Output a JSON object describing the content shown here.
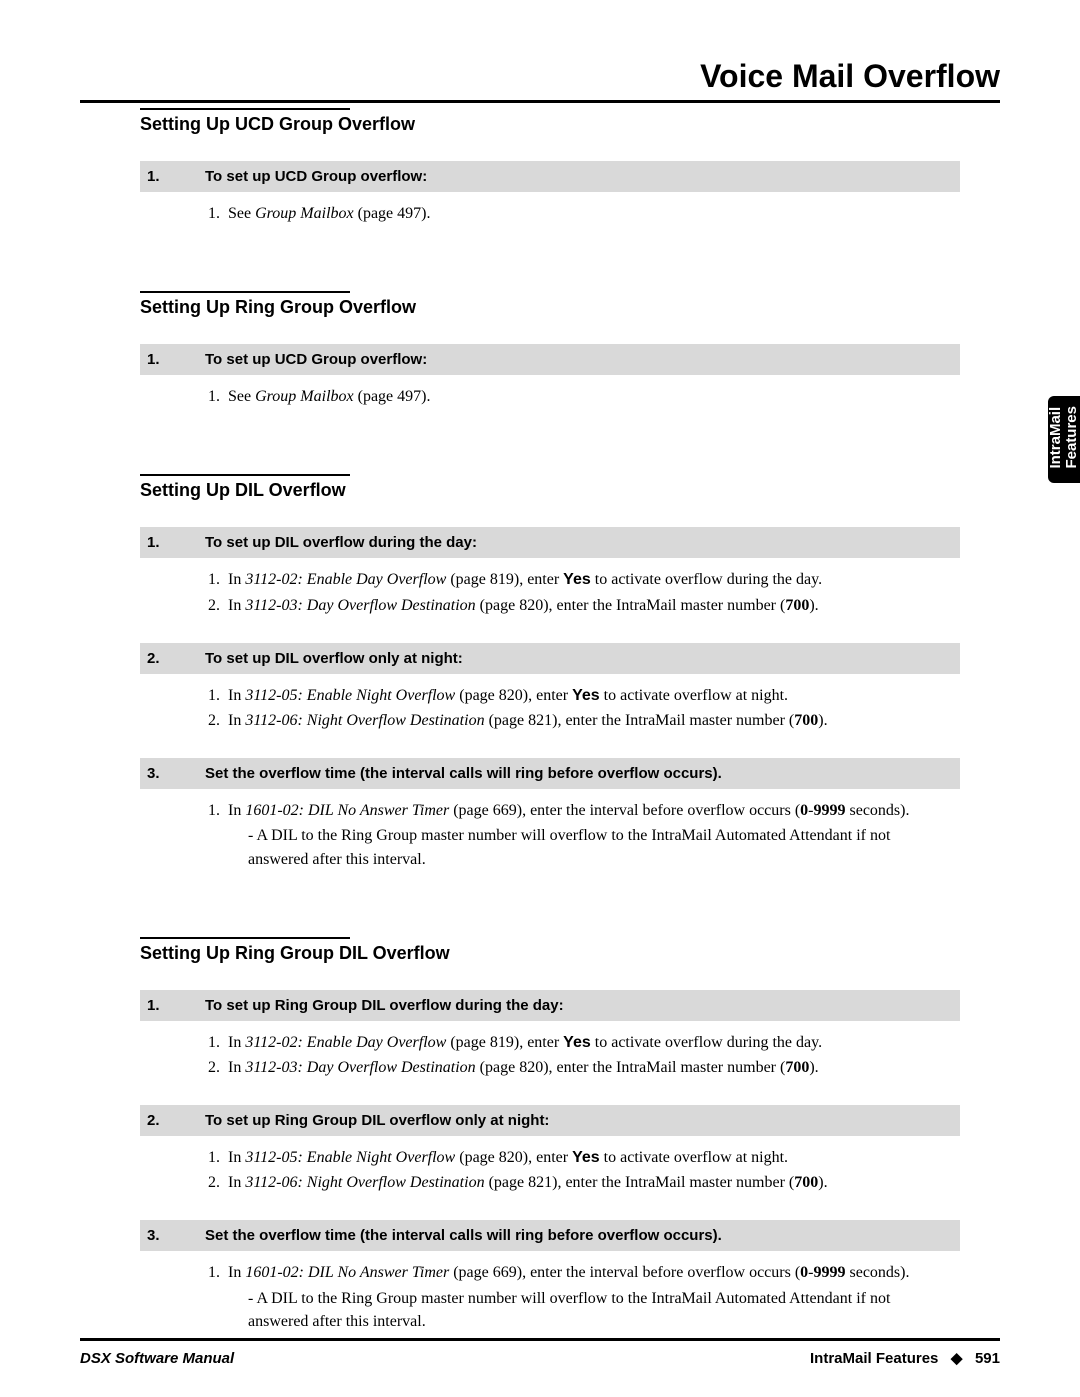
{
  "page_title": "Voice Mail Overflow",
  "tab_label": "IntraMail Features",
  "footer": {
    "left": "DSX Software Manual",
    "right_label": "IntraMail Features",
    "diamond": "◆",
    "page": "591"
  },
  "sections": [
    {
      "heading": "Setting Up UCD Group Overflow",
      "steps": [
        {
          "num": "1.",
          "title": "To set up UCD Group overflow:",
          "items": [
            {
              "html": "See <em>Group Mailbox</em> (page 497)."
            }
          ]
        }
      ]
    },
    {
      "heading": "Setting Up Ring Group Overflow",
      "steps": [
        {
          "num": "1.",
          "title": "To set up UCD Group overflow:",
          "items": [
            {
              "html": "See <em>Group Mailbox</em> (page 497)."
            }
          ]
        }
      ]
    },
    {
      "heading": "Setting Up DIL Overflow",
      "steps": [
        {
          "num": "1.",
          "title": "To set up DIL overflow during the day:",
          "items": [
            {
              "html": "In <em>3112-02: Enable Day Overflow</em> (page 819), enter <b>Yes</b> to activate overflow during the day."
            },
            {
              "html": "In <em>3112-03: Day Overflow Destination</em> (page 820), enter the IntraMail master number (<span class='serif-bold'>700</span>)."
            }
          ]
        },
        {
          "num": "2.",
          "title": "To set up DIL overflow only at night:",
          "items": [
            {
              "html": "In <em>3112-05: Enable Night Overflow</em> (page 820), enter <b>Yes</b> to activate overflow at night."
            },
            {
              "html": "In <em>3112-06: Night Overflow Destination</em> (page 821), enter the IntraMail master number (<span class='serif-bold'>700</span>)."
            }
          ]
        },
        {
          "num": "3.",
          "title": "Set the overflow time (the interval calls will ring before overflow occurs).",
          "items": [
            {
              "html": "In <em>1601-02: DIL No Answer Timer</em> (page 669), enter the interval before overflow occurs (<span class='serif-bold'>0</span>-<span class='serif-bold'>9999</span> seconds).",
              "sub": [
                "A DIL to the Ring Group master number will overflow to the IntraMail Automated Attendant if not answered after this interval."
              ]
            }
          ]
        }
      ]
    },
    {
      "heading": "Setting Up Ring Group DIL Overflow",
      "steps": [
        {
          "num": "1.",
          "title": "To set up Ring Group DIL overflow during the day:",
          "items": [
            {
              "html": "In <em>3112-02: Enable Day Overflow</em> (page 819), enter <b>Yes</b> to activate overflow during the day."
            },
            {
              "html": "In <em>3112-03: Day Overflow Destination</em> (page 820), enter the IntraMail master number (<span class='serif-bold'>700</span>)."
            }
          ]
        },
        {
          "num": "2.",
          "title": "To set up Ring Group DIL overflow only at night:",
          "items": [
            {
              "html": "In <em>3112-05: Enable Night Overflow</em> (page 820), enter <b>Yes</b> to activate overflow at night."
            },
            {
              "html": "In <em>3112-06: Night Overflow Destination</em> (page 821), enter the IntraMail master number (<span class='serif-bold'>700</span>)."
            }
          ]
        },
        {
          "num": "3.",
          "title": "Set the overflow time (the interval calls will ring before overflow occurs).",
          "items": [
            {
              "html": "In <em>1601-02: DIL No Answer Timer</em> (page 669), enter the interval before overflow occurs (<span class='serif-bold'>0</span>-<span class='serif-bold'>9999</span> seconds).",
              "sub": [
                "A DIL to the Ring Group master number will overflow to the IntraMail Automated Attendant if not answered after this interval."
              ]
            }
          ]
        }
      ]
    }
  ]
}
